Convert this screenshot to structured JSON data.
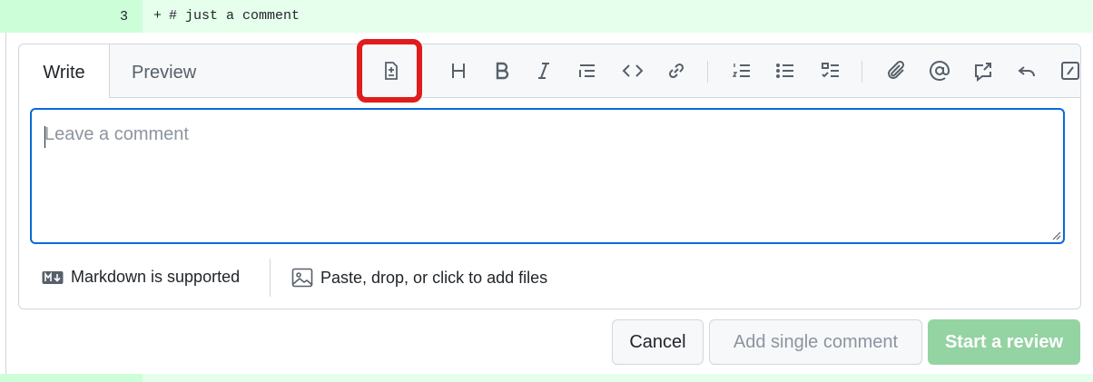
{
  "diff": {
    "line_number": "3",
    "marker": "+",
    "code": "# just a comment"
  },
  "tabs": {
    "write": "Write",
    "preview": "Preview"
  },
  "toolbar": [
    {
      "name": "add-suggestion-icon"
    },
    {
      "name": "heading-icon"
    },
    {
      "name": "bold-icon"
    },
    {
      "name": "italic-icon"
    },
    {
      "name": "quote-icon"
    },
    {
      "name": "code-icon"
    },
    {
      "name": "link-icon"
    },
    {
      "name": "ordered-list-icon"
    },
    {
      "name": "unordered-list-icon"
    },
    {
      "name": "task-list-icon"
    },
    {
      "name": "paperclip-icon"
    },
    {
      "name": "mention-icon"
    },
    {
      "name": "cross-reference-icon"
    },
    {
      "name": "reply-icon"
    },
    {
      "name": "slash-commands-icon"
    }
  ],
  "textarea": {
    "placeholder": "Leave a comment"
  },
  "footer": {
    "markdown": "Markdown is supported",
    "attach": "Paste, drop, or click to add files"
  },
  "buttons": {
    "cancel": "Cancel",
    "single": "Add single comment",
    "review": "Start a review"
  },
  "colors": {
    "accent": "#0969da",
    "highlight": "#e01c1c",
    "added_bg": "#e6ffec",
    "review_button": "#94d3a2"
  }
}
